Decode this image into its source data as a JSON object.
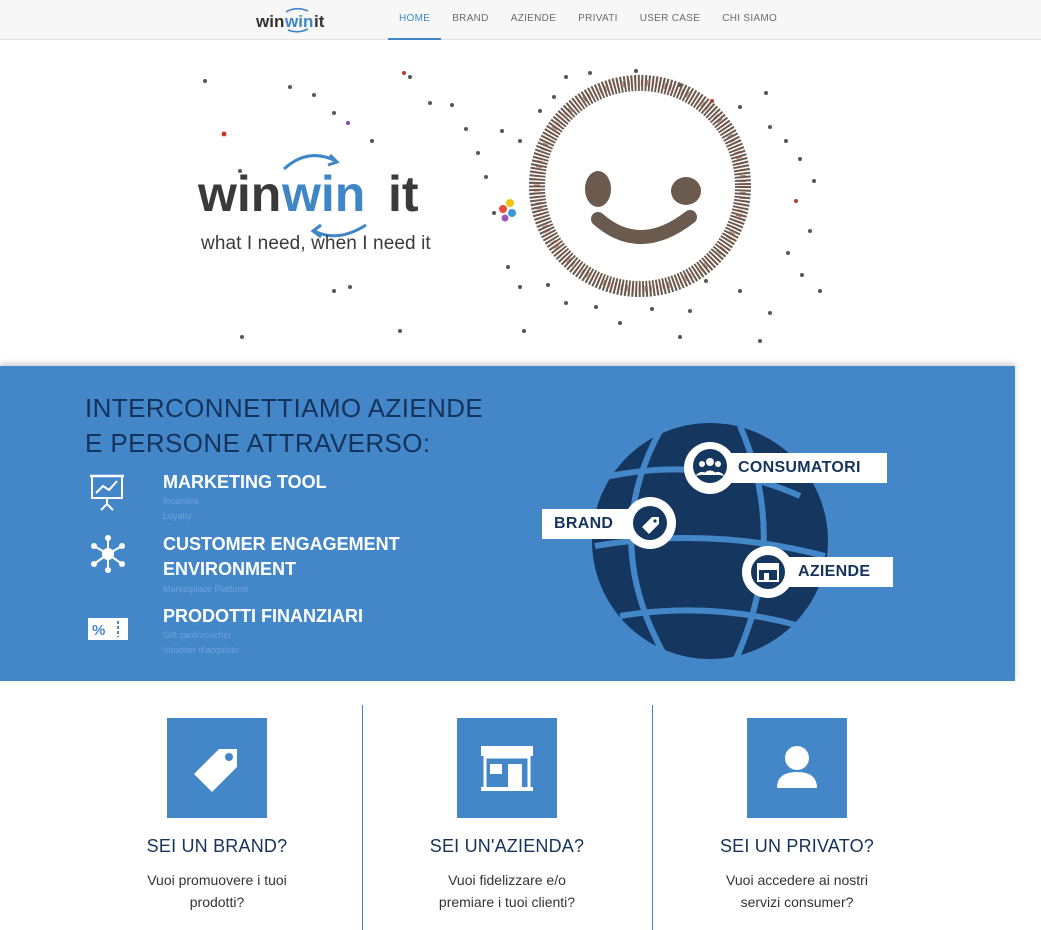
{
  "brand": {
    "name_part1": "win",
    "name_part2": "win",
    "name_part3": "it",
    "tagline": "what I need, when I need it"
  },
  "nav": {
    "items": [
      {
        "label": "HOME",
        "active": true
      },
      {
        "label": "BRAND",
        "active": false
      },
      {
        "label": "AZIENDE",
        "active": false
      },
      {
        "label": "PRIVATI",
        "active": false
      },
      {
        "label": "USER CASE",
        "active": false
      },
      {
        "label": "CHI SIAMO",
        "active": false
      }
    ]
  },
  "band": {
    "title_line1": "INTERCONNETTIAMO AZIENDE",
    "title_line2": "E PERSONE ATTRAVERSO:",
    "features": [
      {
        "title": "MARKETING TOOL",
        "sub1": "Incentive",
        "sub2": "Loyalty",
        "icon": "presentation-chart-icon"
      },
      {
        "title_line1": "CUSTOMER ENGAGEMENT",
        "title_line2": "ENVIRONMENT",
        "sub1": "Marketplace Platform",
        "icon": "network-hub-icon"
      },
      {
        "title": "PRODOTTI FINANZIARI",
        "sub1": "Gift card/voucher",
        "sub2": "Voucher d'acquisto",
        "icon": "percent-ticket-icon"
      }
    ],
    "globe_labels": {
      "consumatori": "CONSUMATORI",
      "brand": "BRAND",
      "aziende": "AZIENDE"
    }
  },
  "cards": [
    {
      "title": "SEI UN BRAND?",
      "desc_line1": "Vuoi promuovere i tuoi",
      "desc_line2": "prodotti?",
      "icon": "tag-icon"
    },
    {
      "title": "SEI UN'AZIENDA?",
      "desc_line1": "Vuoi fidelizzare e/o",
      "desc_line2": "premiare i tuoi clienti?",
      "icon": "store-icon"
    },
    {
      "title": "SEI UN PRIVATO?",
      "desc_line1": "Vuoi accedere ai nostri",
      "desc_line2": "servizi consumer?",
      "icon": "user-icon"
    }
  ],
  "colors": {
    "accent_blue": "#4487c9",
    "dark_navy": "#14335c",
    "logo_gray": "#3a3a3a",
    "logo_blue": "#3f86c7"
  }
}
